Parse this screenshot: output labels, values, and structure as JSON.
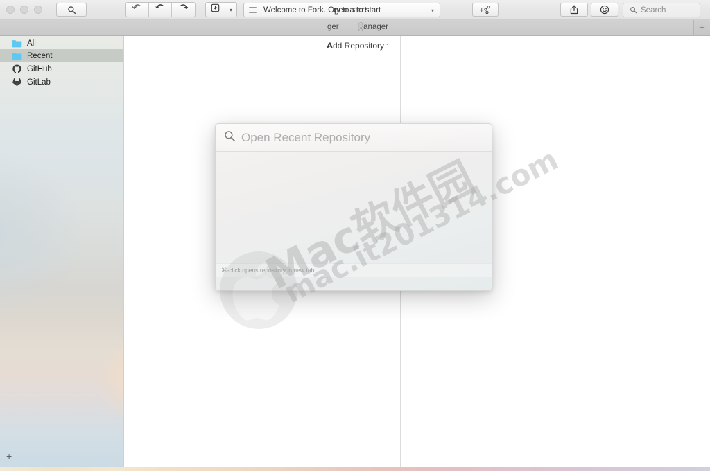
{
  "window": {
    "traffic_lights": [
      "close",
      "minimize",
      "zoom"
    ]
  },
  "toolbar": {
    "search_window_icon": "magnifier-icon",
    "pull_icon": "pull-arrow-icon",
    "push_icon": "push-arrow-icon",
    "fetch_icon": "fetch-arrow-icon",
    "stash_icon": "stash-box-icon",
    "stash_caret": "▾",
    "branch_title": "Welcome to Fork. Open a to start",
    "branch_title_overlap": "ry to start",
    "branch_caret": "▾",
    "new_branch_icon": "new-branch-icon",
    "share_icon": "share-icon",
    "emoji_icon": "smiley-icon",
    "search_placeholder": "Search",
    "search_icon": "search-icon"
  },
  "tabbar": {
    "fragment_1": "\u0001ger",
    "fragment_2": "░anager",
    "new_tab_label": "+"
  },
  "sidebar": {
    "items": [
      {
        "label": "All",
        "icon": "folder-icon",
        "selected": false
      },
      {
        "label": "Recent",
        "icon": "folder-icon",
        "selected": true
      },
      {
        "label": "GitHub",
        "icon": "github-icon",
        "selected": false
      },
      {
        "label": "GitLab",
        "icon": "gitlab-icon",
        "selected": false
      }
    ],
    "add_label": "+",
    "folder_color": "#5ec8f2"
  },
  "content": {
    "add_repository_label": "Add Repository",
    "add_repository_caret": "ˇ"
  },
  "panel": {
    "search_icon": "search-icon",
    "placeholder": "Open Recent Repository",
    "footer_hint": "⌘-click opens repository in new tab"
  },
  "watermark": {
    "line1": "Mac软件园",
    "line2": "mac.it201314.com",
    "logo": "apple-logo-icon"
  },
  "colors": {
    "accent_folder": "#5ec8f2",
    "toolbar_bg": "#e7e7e7",
    "tabbar_bg": "#c9c9c9",
    "selection": "#a0a69e",
    "panel_bg": "#f0efee",
    "text": "#1c1c1c"
  }
}
